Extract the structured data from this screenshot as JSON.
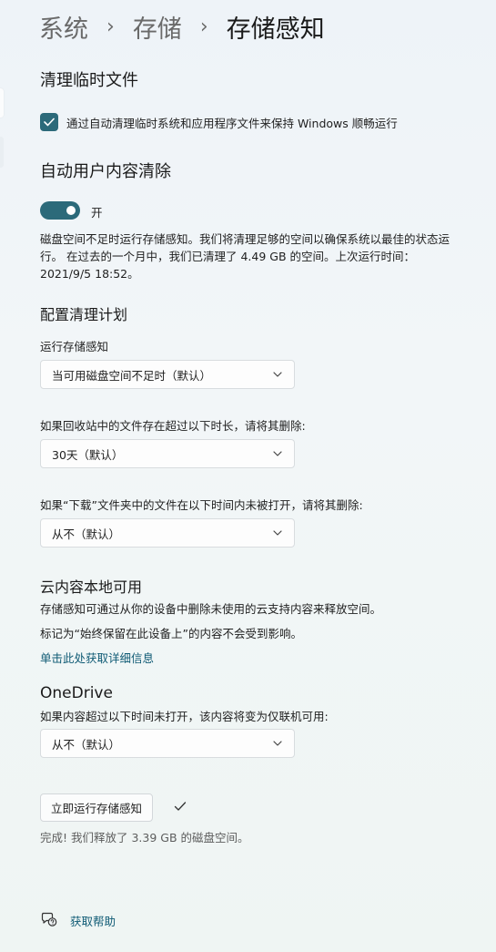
{
  "breadcrumb": {
    "items": [
      "系统",
      "存储"
    ],
    "current": "存储感知"
  },
  "temp_files": {
    "heading": "清理临时文件",
    "checkbox_label": "通过自动清理临时系统和应用程序文件来保持 Windows 顺畅运行",
    "checked": true
  },
  "auto_clean": {
    "heading": "自动用户内容清除",
    "toggle_state": "开",
    "description": "磁盘空间不足时运行存储感知。我们将清理足够的空间以确保系统以最佳的状态运行。 在过去的一个月中，我们已清理了 4.49 GB 的空间。上次运行时间：2021/9/5 18:52。"
  },
  "schedule": {
    "heading": "配置清理计划",
    "run_label": "运行存储感知",
    "run_value": "当可用磁盘空间不足时（默认）",
    "recycle_label": "如果回收站中的文件存在超过以下时长，请将其删除:",
    "recycle_value": "30天（默认）",
    "downloads_label": "如果“下载”文件夹中的文件在以下时间内未被打开，请将其删除:",
    "downloads_value": "从不（默认）"
  },
  "cloud": {
    "heading": "云内容本地可用",
    "line1": "存储感知可通过从你的设备中删除未使用的云支持内容来释放空间。",
    "line2": "标记为“始终保留在此设备上”的内容不会受到影响。",
    "link": "单击此处获取详细信息"
  },
  "onedrive": {
    "heading": "OneDrive",
    "label": "如果内容超过以下时间未打开，该内容将变为仅联机可用:",
    "value": "从不（默认）"
  },
  "run_now": {
    "button": "立即运行存储感知",
    "result": "完成! 我们释放了 3.39 GB 的磁盘空间。"
  },
  "help": {
    "label": "获取帮助"
  },
  "colors": {
    "accent": "#2c6a7a",
    "link": "#0e5a74"
  }
}
